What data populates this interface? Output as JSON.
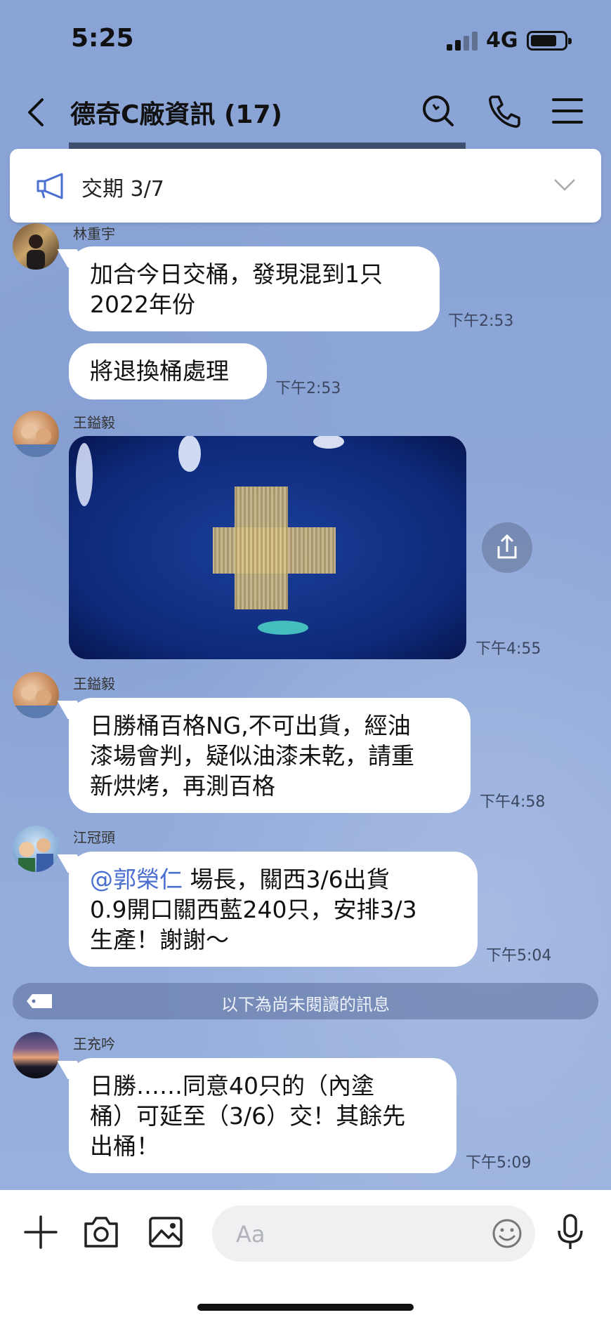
{
  "status_bar": {
    "time": "5:25",
    "network": "4G"
  },
  "header": {
    "title": "德奇C廠資訊 (17)",
    "icons": [
      "back-icon",
      "search-icon",
      "phone-icon",
      "menu-icon"
    ]
  },
  "announcement": {
    "text": "交期 3/7",
    "icon": "megaphone-icon"
  },
  "messages": [
    {
      "sender": "林重宇",
      "text": "加合今日交桶，發現混到1只\n2022年份",
      "time": "下午2:53"
    },
    {
      "text": "將退換桶處理",
      "time": "下午2:53"
    },
    {
      "sender": "王鎰毅",
      "type": "image",
      "time": "下午4:55"
    },
    {
      "sender": "王鎰毅",
      "text": "日勝桶百格NG,不可出貨，經油\n漆場會判，疑似油漆未乾，請重\n新烘烤，再測百格",
      "time": "下午4:58"
    },
    {
      "sender": "江冠頭",
      "mention": "@郭榮仁",
      "text": " 場長，關西3/6出貨\n0.9開口關西藍240只，安排3/3\n生產！謝謝～",
      "time": "下午5:04"
    },
    {
      "sender": "王充吟",
      "text": "日勝……同意40只的（內塗\n桶）可延至（3/6）交！其餘先\n出桶！",
      "time": "下午5:09"
    }
  ],
  "unread_divider": "以下為尚未閱讀的訊息",
  "input": {
    "placeholder": "Aa",
    "value": ""
  },
  "colors": {
    "background": "#8ea7d8",
    "bubble": "#ffffff",
    "mention": "#4a6fd1",
    "divider": "#6478a5"
  }
}
